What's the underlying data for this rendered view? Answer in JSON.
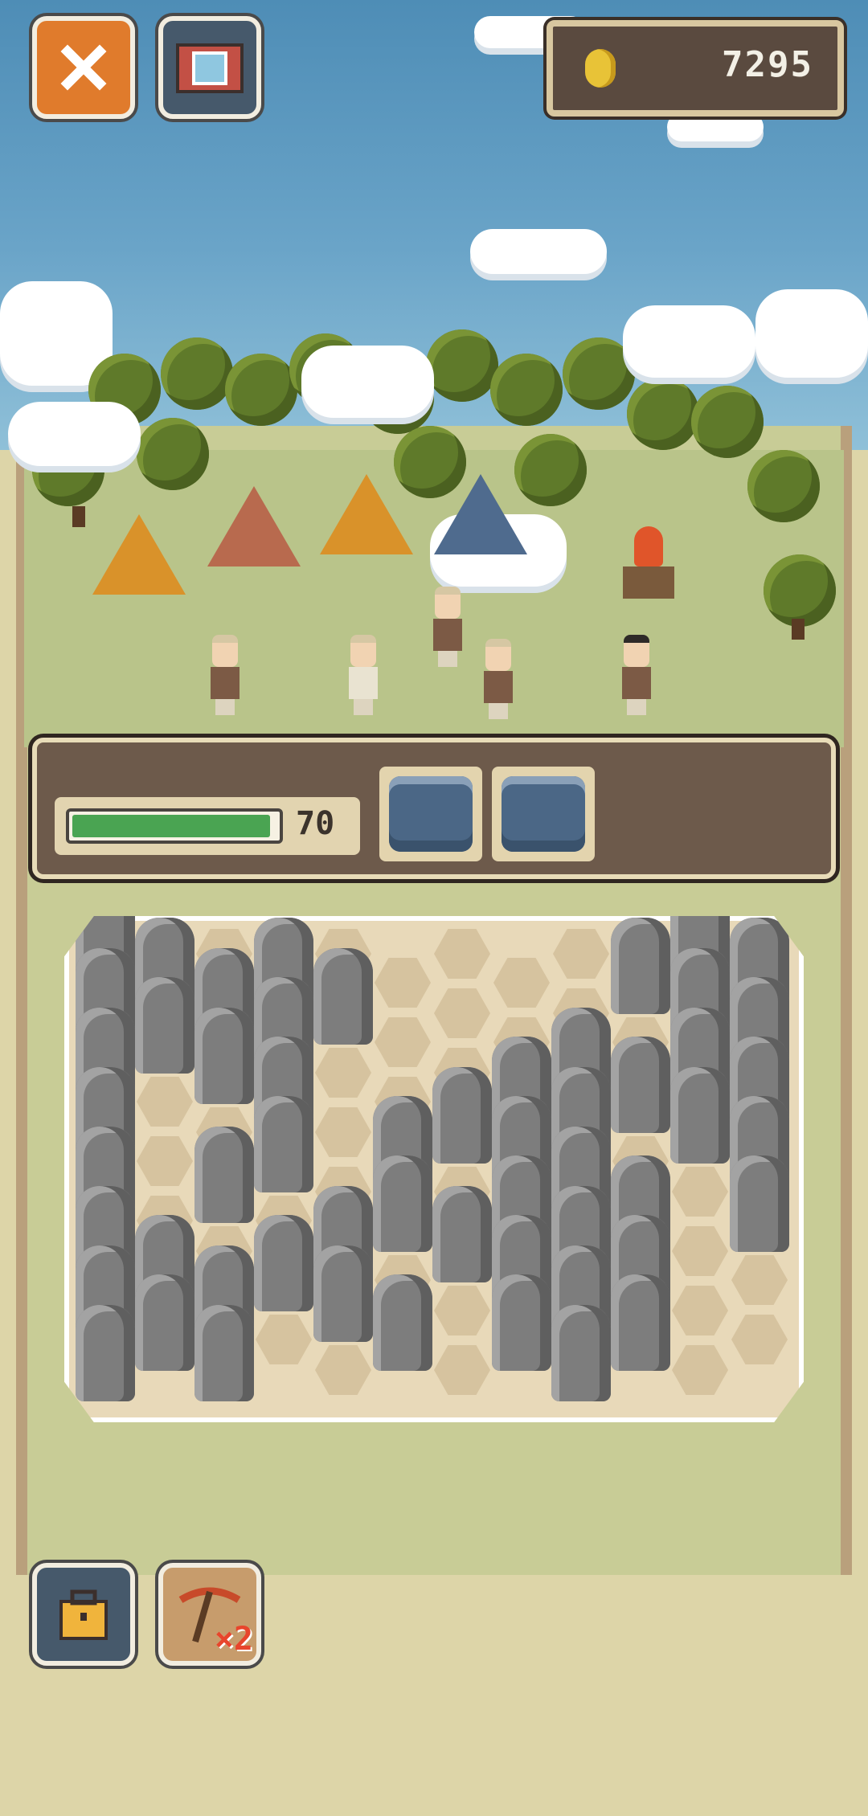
{
  "header": {
    "close_icon": "close-x-icon",
    "camera_icon": "camera-icon",
    "coins": "7295"
  },
  "dig_panel": {
    "progress_percent": 0.97,
    "progress_value": "70",
    "slots": [
      {
        "icon": "mine-cart-icon"
      },
      {
        "icon": "mine-cart-icon"
      }
    ]
  },
  "tools": {
    "toolbox_icon": "toolbox-icon",
    "pickaxe_icon": "pickaxe-icon",
    "pickaxe_multiplier": "×2"
  },
  "colors": {
    "close_button": "#e07b2c",
    "camera_button": "#46596b",
    "progress_fill": "#4aa452",
    "panel": "#6d5a4b"
  }
}
